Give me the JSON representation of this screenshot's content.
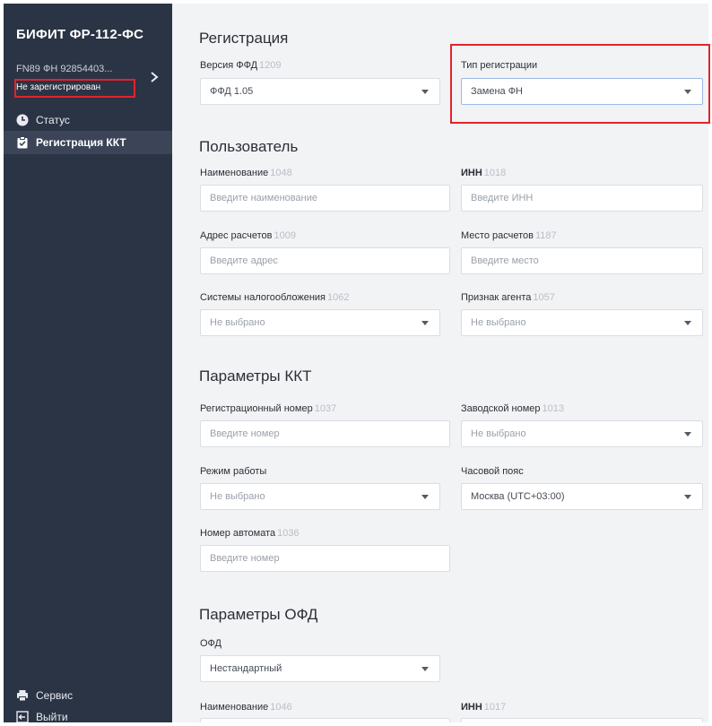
{
  "sidebar": {
    "brand": "БИФИТ ФР-112-ФС",
    "device_id": "FN89 ФН 92854403...",
    "device_status": "Не зарегистрирован",
    "nav": [
      {
        "label": "Статус",
        "icon": "clock-icon"
      },
      {
        "label": "Регистрация ККТ",
        "icon": "clipboard-check-icon"
      },
      {
        "label": "Сервис",
        "icon": "printer-icon"
      },
      {
        "label": "Выйти",
        "icon": "logout-icon"
      }
    ]
  },
  "registration": {
    "title": "Регистрация",
    "ffd_version": {
      "label": "Версия ФФД",
      "code": "1209",
      "value": "ФФД 1.05"
    },
    "reg_type": {
      "label": "Тип регистрации",
      "value": "Замена ФН"
    }
  },
  "user": {
    "title": "Пользователь",
    "name": {
      "label": "Наименование",
      "code": "1048",
      "placeholder": "Введите наименование"
    },
    "inn": {
      "label": "ИНН",
      "code": "1018",
      "placeholder": "Введите ИНН"
    },
    "address": {
      "label": "Адрес расчетов",
      "code": "1009",
      "placeholder": "Введите адрес"
    },
    "place": {
      "label": "Место расчетов",
      "code": "1187",
      "placeholder": "Введите место"
    },
    "tax": {
      "label": "Системы налогообложения",
      "code": "1062",
      "value": "Не выбрано"
    },
    "agent": {
      "label": "Признак агента",
      "code": "1057",
      "value": "Не выбрано"
    }
  },
  "kkt": {
    "title": "Параметры ККТ",
    "reg_number": {
      "label": "Регистрационный номер",
      "code": "1037",
      "placeholder": "Введите номер"
    },
    "serial": {
      "label": "Заводской номер",
      "code": "1013",
      "value": "Не выбрано"
    },
    "mode": {
      "label": "Режим работы",
      "value": "Не выбрано"
    },
    "timezone": {
      "label": "Часовой пояс",
      "value": "Москва (UTC+03:00)"
    },
    "machine": {
      "label": "Номер автомата",
      "code": "1036",
      "placeholder": "Введите номер"
    }
  },
  "ofd": {
    "title": "Параметры ОФД",
    "ofd": {
      "label": "ОФД",
      "value": "Нестандартный"
    },
    "name": {
      "label": "Наименование",
      "code": "1046"
    },
    "inn": {
      "label": "ИНН",
      "code": "1017"
    }
  },
  "colors": {
    "sidebar_bg": "#2b3445",
    "highlight_box": "#e3232a",
    "page_bg": "#f2f3f5"
  }
}
